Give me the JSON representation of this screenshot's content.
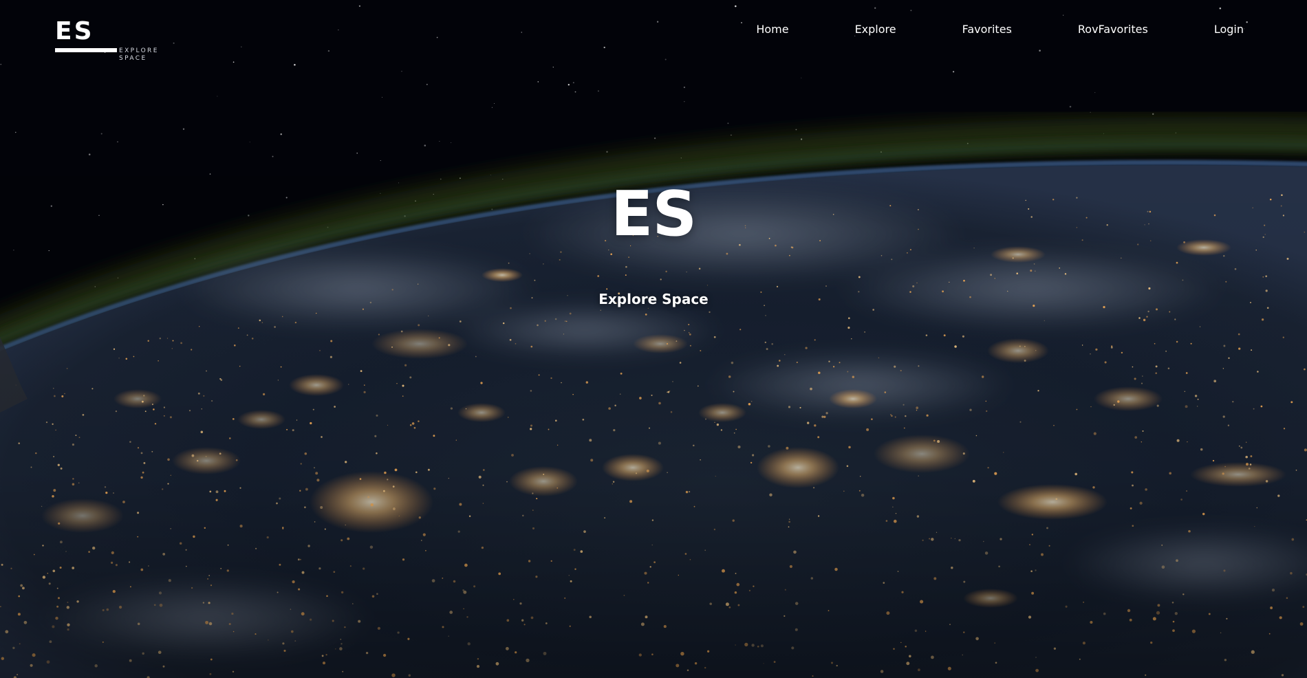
{
  "logo": {
    "mark": "ES",
    "sub_line1": "EXPLORE",
    "sub_line2": "SPACE"
  },
  "nav": {
    "items": [
      {
        "label": "Home"
      },
      {
        "label": "Explore"
      },
      {
        "label": "Favorites"
      },
      {
        "label": "RovFavorites"
      },
      {
        "label": "Login"
      }
    ]
  },
  "hero": {
    "title": "ES",
    "subtitle": "Explore Space"
  },
  "colors": {
    "text": "#ffffff",
    "space": "#02040a",
    "atmosphere": "#3a4a1e",
    "ocean": "#1a2434",
    "city_lights": "#ffc77a"
  }
}
